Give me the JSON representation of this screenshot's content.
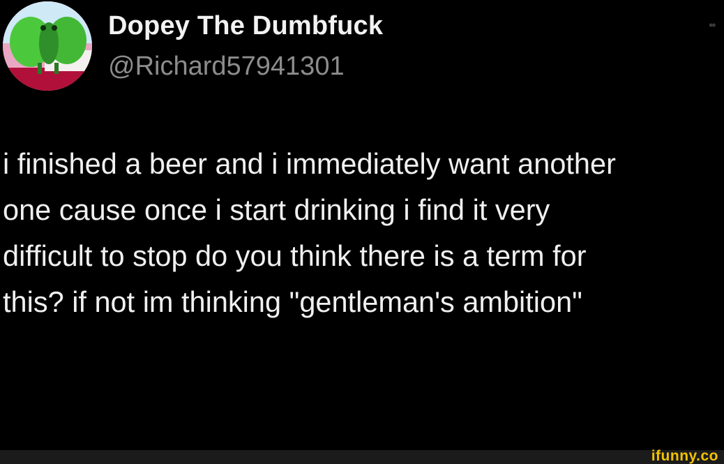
{
  "tweet": {
    "author": {
      "display_name": "Dopey The Dumbfuck",
      "handle": "@Richard57941301",
      "avatar_icon": "green-character-avatar"
    },
    "more_icon": "more-dots-icon",
    "body_lines": [
      "i finished a beer and i immediately want another",
      "one cause once i start drinking i find it very",
      "difficult to stop do you think there is a term for",
      "this? if not im thinking \"gentleman's ambition\""
    ]
  },
  "watermark": {
    "text": "ifunny.co",
    "color": "#f2c200"
  },
  "colors": {
    "background": "#000000",
    "name": "#f2f2f2",
    "handle": "#8d8d8d",
    "body": "#f0f0f0"
  }
}
